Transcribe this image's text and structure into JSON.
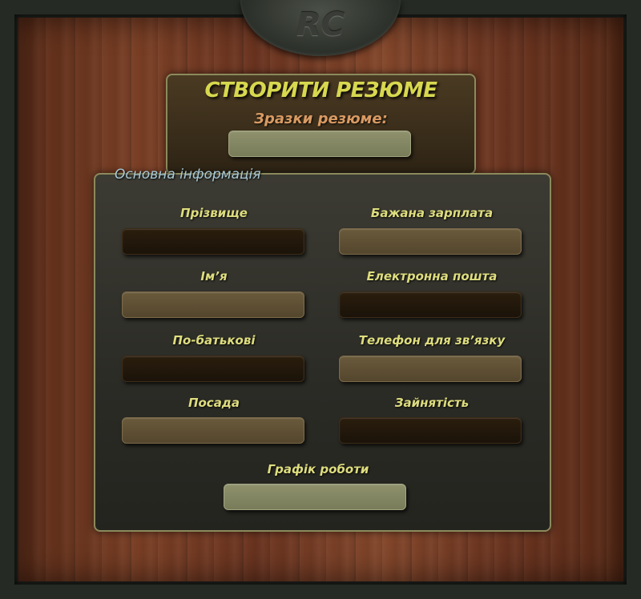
{
  "logo": {
    "text": "RC"
  },
  "header": {
    "title": "СТВОРИТИ РЕЗЮМЕ",
    "samples_label": "Зразки резюме:"
  },
  "main": {
    "section_title": "Основна інформація",
    "fields": {
      "surname": "Прізвище",
      "name": "Ім’я",
      "patronymic": "По-батькові",
      "position": "Посада",
      "salary": "Бажана зарплата",
      "email": "Електронна пошта",
      "phone": "Телефон для зв’язку",
      "employment": "Зайнятість",
      "schedule": "Графік роботи"
    }
  },
  "colors": {
    "title": "#d7d84f",
    "samples_label": "#d99a62",
    "section_title": "#a9c9d6",
    "field_label": "#dedd7e",
    "panel_border": "#8b8a5c"
  }
}
